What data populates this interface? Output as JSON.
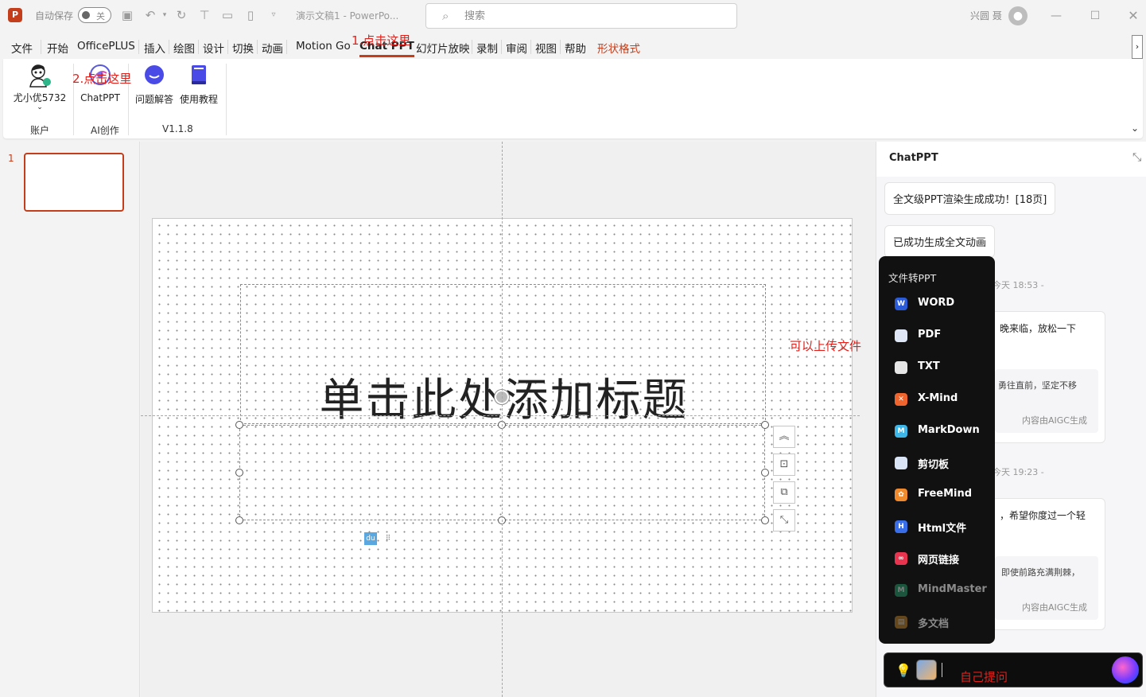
{
  "titlebar": {
    "app_logo": "P",
    "autosave_label": "自动保存",
    "autosave_state": "关",
    "doc_title": "演示文稿1 - PowerPo...",
    "search_placeholder": "搜索",
    "user_name": "兴圆 聂",
    "icons": [
      "save-icon",
      "undo-icon",
      "redo-icon",
      "present-icon",
      "open-icon",
      "new-icon",
      "customize-icon"
    ]
  },
  "tabs": [
    "文件",
    "开始",
    "OfficePLUS",
    "插入",
    "绘图",
    "设计",
    "切换",
    "动画",
    "Motion Go",
    "Chat PPT",
    "幻灯片放映",
    "录制",
    "审阅",
    "视图",
    "帮助",
    "形状格式"
  ],
  "active_tab": "Chat PPT",
  "ribbon": {
    "account_name": "尤小优5732",
    "account_group": "账户",
    "chatppt_label": "ChatPPT",
    "ai_group": "AI创作",
    "qa_label": "问题解答",
    "tutorial_label": "使用教程",
    "version_group": "V1.1.8"
  },
  "annotations": {
    "step1": "1.点击这里",
    "step2": "2.点击这里",
    "upload_hint": "可以上传文件",
    "ask_hint": "自己提问",
    "color": "#e0201a"
  },
  "thumbnails": {
    "slide_number": "1"
  },
  "slide": {
    "title_placeholder": "单击此处添加标题"
  },
  "pane": {
    "title": "ChatPPT",
    "bubble1": "全文级PPT渲染生成成功！[18页]",
    "bubble2": "已成功生成全文动画",
    "time1": "今天 18:53 -",
    "msg1_text": "晚来临，放松一下",
    "msg1_sub": "勇往直前，坚定不移",
    "msg1_tag": "内容由AIGC生成",
    "time2": "今天 19:23 -",
    "msg2_text": "，希望你度过一个轻",
    "msg2_sub": "即使前路充满荆棘，",
    "msg2_tag": "内容由AIGC生成"
  },
  "file_menu": {
    "title": "文件转PPT",
    "items": [
      {
        "label": "WORD",
        "icon": "word-icon",
        "color": "#2b5bd7",
        "glyph": "W"
      },
      {
        "label": "PDF",
        "icon": "pdf-icon",
        "color": "#dfe6f5",
        "glyph": ""
      },
      {
        "label": "TXT",
        "icon": "txt-icon",
        "color": "#e6e6e6",
        "glyph": ""
      },
      {
        "label": "X-Mind",
        "icon": "xmind-icon",
        "color": "#f0642d",
        "glyph": "✕"
      },
      {
        "label": "MarkDown",
        "icon": "markdown-icon",
        "color": "#3fb6e8",
        "glyph": "M"
      },
      {
        "label": "剪切板",
        "icon": "clipboard-icon",
        "color": "#d9e4f7",
        "glyph": ""
      },
      {
        "label": "FreeMind",
        "icon": "freemind-icon",
        "color": "#f08a2c",
        "glyph": "✿"
      },
      {
        "label": "Html文件",
        "icon": "html-icon",
        "color": "#3a6ee8",
        "glyph": "H"
      },
      {
        "label": "网页链接",
        "icon": "link-icon",
        "color": "#e8344e",
        "glyph": "∞"
      },
      {
        "label": "MindMaster",
        "icon": "mindmaster-icon",
        "color": "#2aa876",
        "glyph": "M"
      },
      {
        "label": "多文档",
        "icon": "multidoc-icon",
        "color": "#c98a2c",
        "glyph": "▤"
      }
    ],
    "disabled": [
      "MindMaster",
      "多文档"
    ]
  },
  "ask_box": {
    "value": ""
  }
}
